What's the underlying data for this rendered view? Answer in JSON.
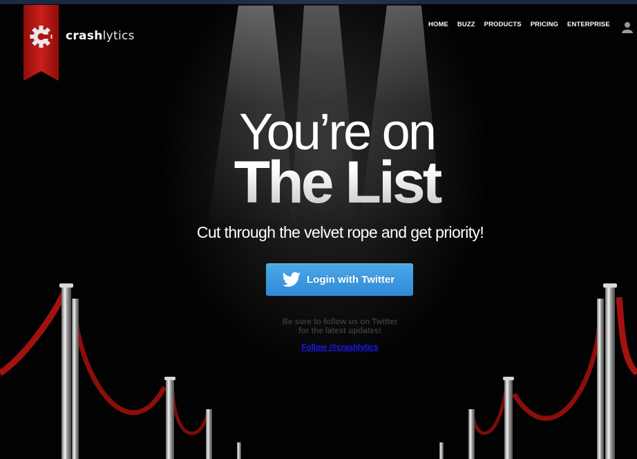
{
  "header": {
    "brand_bold": "crash",
    "brand_light": "lytics",
    "nav": [
      {
        "label": "HOME"
      },
      {
        "label": "BUZZ"
      },
      {
        "label": "PRODUCTS"
      },
      {
        "label": "PRICING"
      },
      {
        "label": "ENTERPRISE"
      }
    ],
    "icons": {
      "logo": "gear-logo-icon",
      "user": "user-icon"
    },
    "colors": {
      "ribbon": "#b3140f",
      "topline": "#1b2a44"
    }
  },
  "hero": {
    "line1": "You’re on",
    "line2": "The List",
    "tagline": "Cut through the velvet rope and get priority!"
  },
  "cta": {
    "label": "Login with Twitter",
    "icon": "twitter-bird-icon",
    "color": "#3b9ce0"
  },
  "follow": {
    "note_line1": "Be sure to follow us on Twitter",
    "note_line2": "for the latest updates!",
    "link": "Follow @crashlytics"
  }
}
